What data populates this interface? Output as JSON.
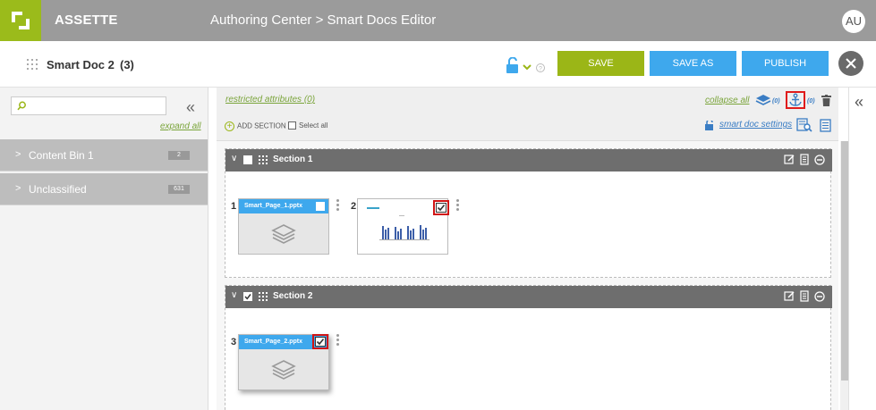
{
  "app": {
    "brand": "ASSETTE",
    "breadcrumb": "Authoring Center > Smart Docs Editor",
    "user_initials": "AU"
  },
  "doc": {
    "title": "Smart Doc 2",
    "count": "(3)"
  },
  "actions": {
    "save": "SAVE",
    "save_as": "SAVE AS",
    "publish": "PUBLISH"
  },
  "sidebar": {
    "search_placeholder": "",
    "expand_all": "expand all",
    "bins": [
      {
        "label": "Content Bin 1",
        "count": "2"
      },
      {
        "label": "Unclassified",
        "count": "631"
      }
    ]
  },
  "toolbar": {
    "restricted": "restricted attributes (0)",
    "add_section": "ADD SECTION",
    "select_all": "Select all",
    "collapse_all": "collapse all",
    "layers_count": "(0)",
    "anchor_count": "(0)",
    "smart_doc_settings": "smart doc settings"
  },
  "sections": [
    {
      "label": "Section 1",
      "pages": [
        {
          "num": "1",
          "name": "Smart_Page_1.pptx"
        },
        {
          "num": "2",
          "name": ""
        }
      ]
    },
    {
      "label": "Section 2",
      "pages": [
        {
          "num": "3",
          "name": "Smart_Page_2.pptx"
        }
      ]
    }
  ],
  "colors": {
    "accent_green": "#9bb617",
    "accent_blue": "#3ea8ed",
    "highlight_red": "#d01414"
  }
}
